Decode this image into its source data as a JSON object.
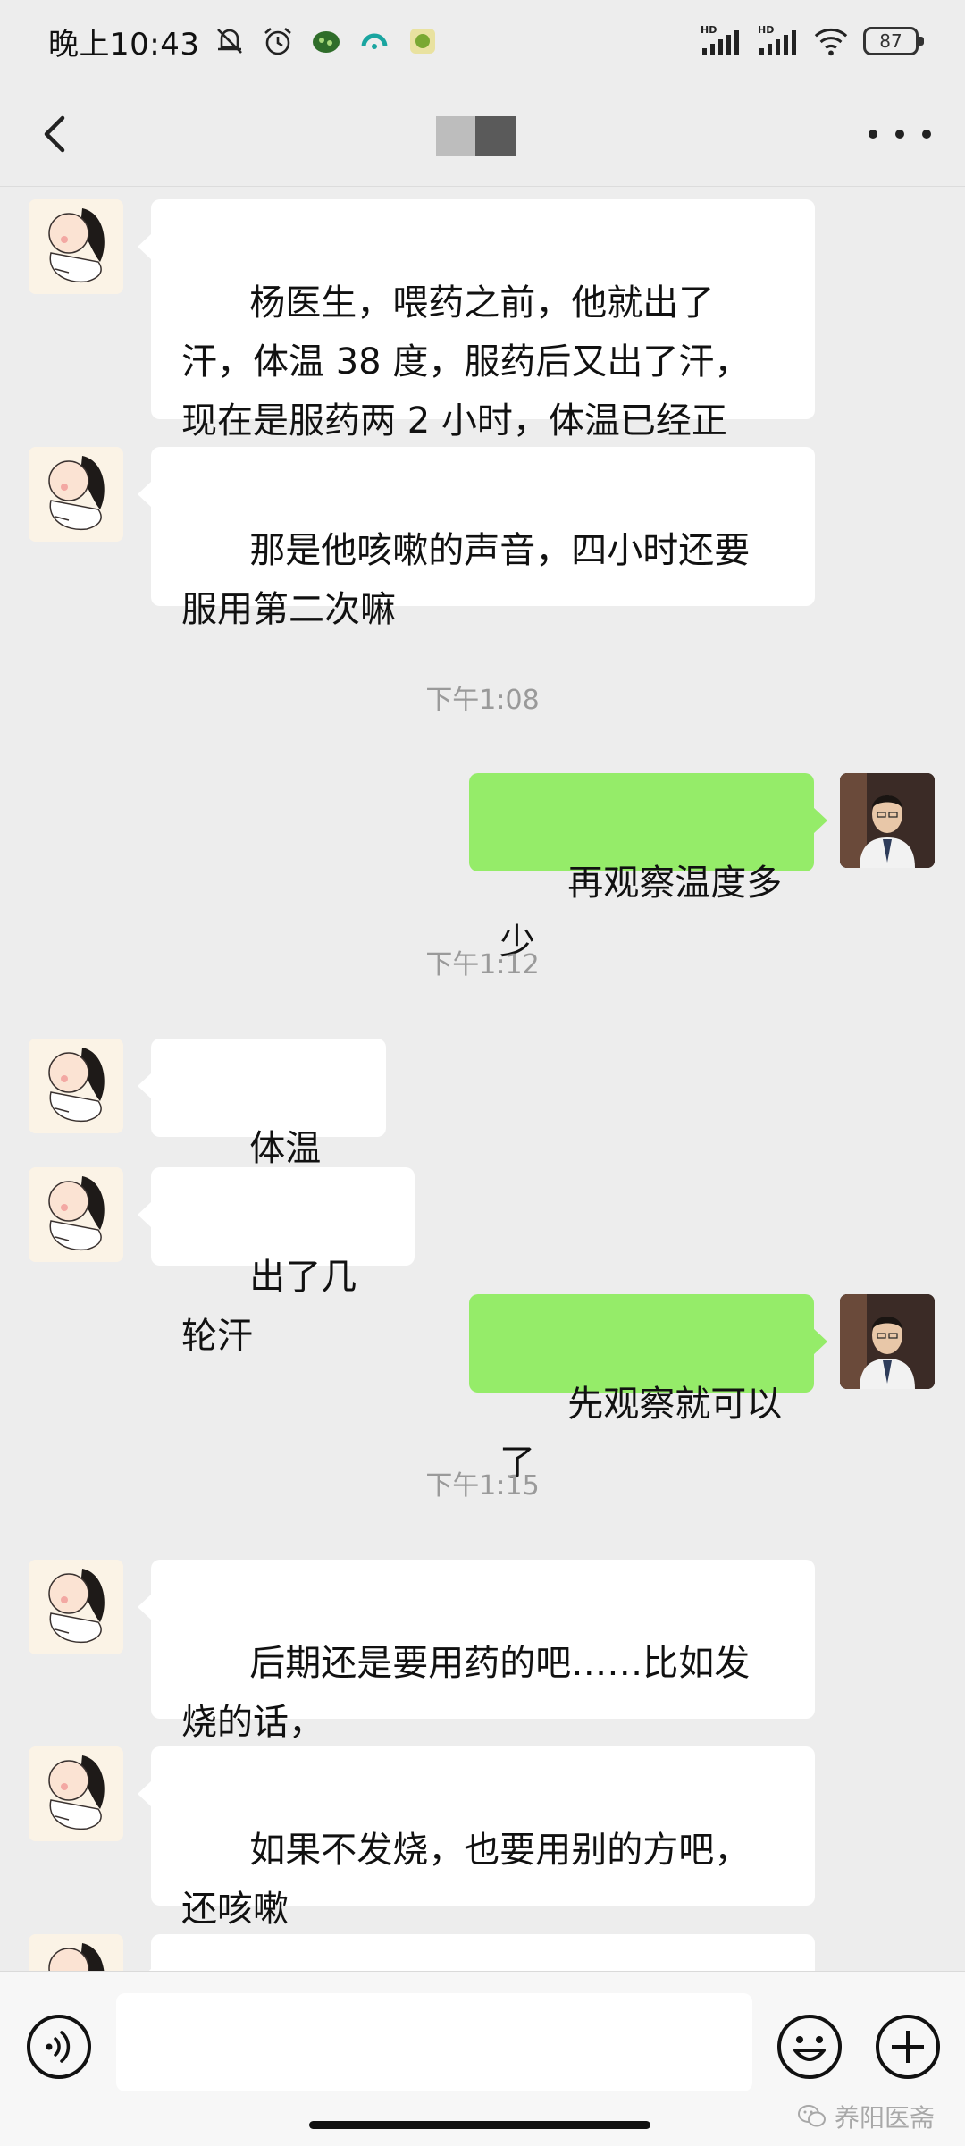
{
  "status_bar": {
    "time": "晚上10:43",
    "battery": "87",
    "signal_label": "HD"
  },
  "nav": {
    "back_icon": "chevron-left-icon",
    "more_icon": "more-dots-icon"
  },
  "messages": [
    {
      "type": "in",
      "text": "杨医生，喂药之前，他就出了汗，体温 38 度，服药后又出了汗，现在是服药两 2 小时，体温已经正常，"
    },
    {
      "type": "in",
      "text": "那是他咳嗽的声音，四小时还要服用第二次嘛"
    },
    {
      "type": "time",
      "text": "下午1:08"
    },
    {
      "type": "out",
      "text": "再观察温度多少"
    },
    {
      "type": "time",
      "text": "下午1:12"
    },
    {
      "type": "in",
      "text": "体温正常，"
    },
    {
      "type": "in",
      "text": "出了几轮汗"
    },
    {
      "type": "out",
      "text": "先观察就可以了"
    },
    {
      "type": "time",
      "text": "下午1:15"
    },
    {
      "type": "in",
      "text": "后期还是要用药的吧……比如发烧的话，"
    },
    {
      "type": "in",
      "text": "如果不发烧，也要用别的方吧，还咳嗽"
    }
  ],
  "input_bar": {
    "placeholder": "",
    "watermark": "养阳医斋"
  },
  "colors": {
    "background": "#ededed",
    "incoming_bubble": "#ffffff",
    "outgoing_bubble": "#95ec69"
  }
}
